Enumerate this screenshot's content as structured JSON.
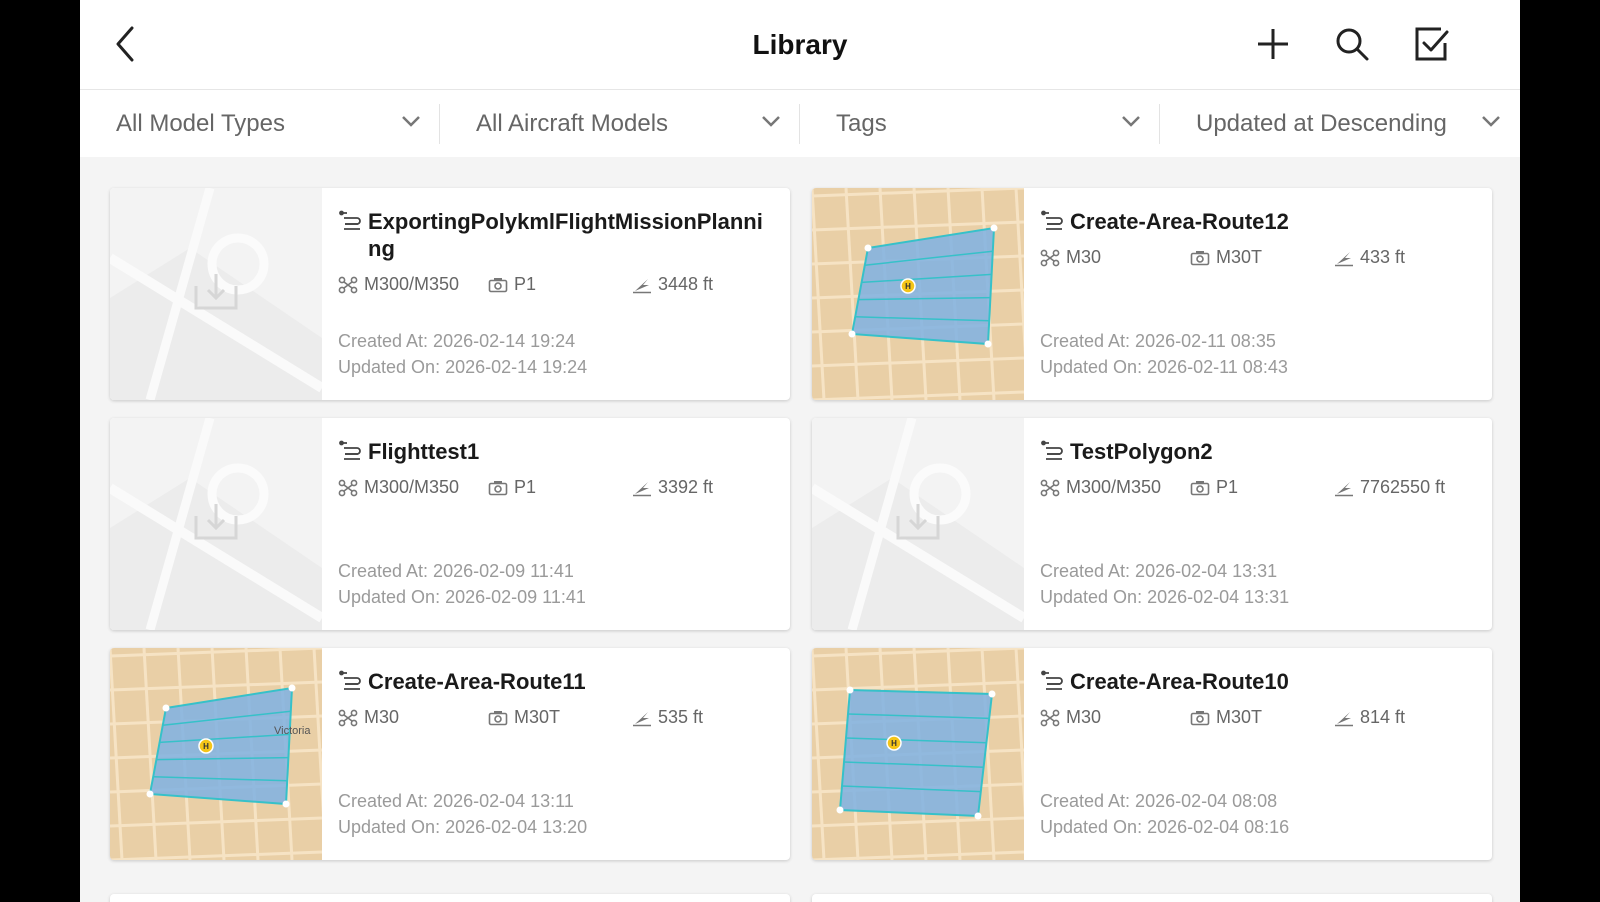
{
  "header": {
    "title": "Library"
  },
  "icons": {
    "back": "chevron-left-icon",
    "add": "plus-icon",
    "search": "search-icon",
    "select": "checkbox-icon"
  },
  "filters": [
    {
      "label": "All Model Types"
    },
    {
      "label": "All Aircraft Models"
    },
    {
      "label": "Tags"
    },
    {
      "label": "Updated at Descending"
    }
  ],
  "colors": {
    "map_bg": "#e9cfa6",
    "area_fill": "#7fb2e3",
    "route_line": "#36c1c9",
    "marker": "#f5c518"
  },
  "cards": [
    {
      "name": "ExportingPolykmlFlightMissionPlanning",
      "aircraft": "M300/M350",
      "camera": "P1",
      "height": "3448 ft",
      "created": "Created At: 2026-02-14 19:24",
      "updated": "Updated On: 2026-02-14 19:24",
      "thumbnail": "placeholder"
    },
    {
      "name": "Create-Area-Route12",
      "aircraft": "M30",
      "camera": "M30T",
      "height": "433 ft",
      "created": "Created At: 2026-02-11 08:35",
      "updated": "Updated On: 2026-02-11 08:43",
      "thumbnail": "map"
    },
    {
      "name": "Flighttest1",
      "aircraft": "M300/M350",
      "camera": "P1",
      "height": "3392 ft",
      "created": "Created At: 2026-02-09 11:41",
      "updated": "Updated On: 2026-02-09 11:41",
      "thumbnail": "placeholder"
    },
    {
      "name": "TestPolygon2",
      "aircraft": "M300/M350",
      "camera": "P1",
      "height": "7762550 ft",
      "created": "Created At: 2026-02-04 13:31",
      "updated": "Updated On: 2026-02-04 13:31",
      "thumbnail": "placeholder"
    },
    {
      "name": "Create-Area-Route11",
      "aircraft": "M30",
      "camera": "M30T",
      "height": "535 ft",
      "created": "Created At: 2026-02-04 13:11",
      "updated": "Updated On: 2026-02-04 13:20",
      "thumbnail": "map",
      "map_label": "Victoria"
    },
    {
      "name": "Create-Area-Route10",
      "aircraft": "M30",
      "camera": "M30T",
      "height": "814 ft",
      "created": "Created At: 2026-02-04 08:08",
      "updated": "Updated On: 2026-02-04 08:16",
      "thumbnail": "map"
    }
  ]
}
